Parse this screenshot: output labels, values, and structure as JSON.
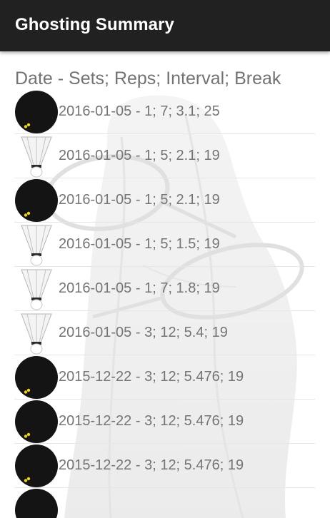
{
  "toolbar": {
    "title": "Ghosting Summary"
  },
  "list": {
    "header": "Date - Sets; Reps; Interval; Break",
    "items": [
      {
        "icon": "squash-ball-icon",
        "text": "2016-01-05 - 1; 7; 3.1; 25"
      },
      {
        "icon": "shuttlecock-icon",
        "text": "2016-01-05 - 1; 5; 2.1; 19"
      },
      {
        "icon": "squash-ball-icon",
        "text": "2016-01-05 - 1; 5; 2.1; 19"
      },
      {
        "icon": "shuttlecock-icon",
        "text": "2016-01-05 - 1; 5; 1.5; 19"
      },
      {
        "icon": "shuttlecock-icon",
        "text": "2016-01-05 - 1; 7; 1.8; 19"
      },
      {
        "icon": "shuttlecock-icon",
        "text": "2016-01-05 - 3; 12; 5.4; 19"
      },
      {
        "icon": "squash-ball-icon",
        "text": "2015-12-22 - 3; 12; 5.476; 19"
      },
      {
        "icon": "squash-ball-icon",
        "text": "2015-12-22 - 3; 12; 5.476; 19"
      },
      {
        "icon": "squash-ball-icon",
        "text": "2015-12-22 - 3; 12; 5.476; 19"
      },
      {
        "icon": "squash-ball-icon",
        "text": ""
      }
    ]
  },
  "colors": {
    "toolbar_bg": "#212121",
    "toolbar_text": "#ffffff",
    "header_text": "#737373",
    "row_text": "#757575",
    "divider": "#e6e6e6",
    "squash_dot": "#f5d400"
  }
}
